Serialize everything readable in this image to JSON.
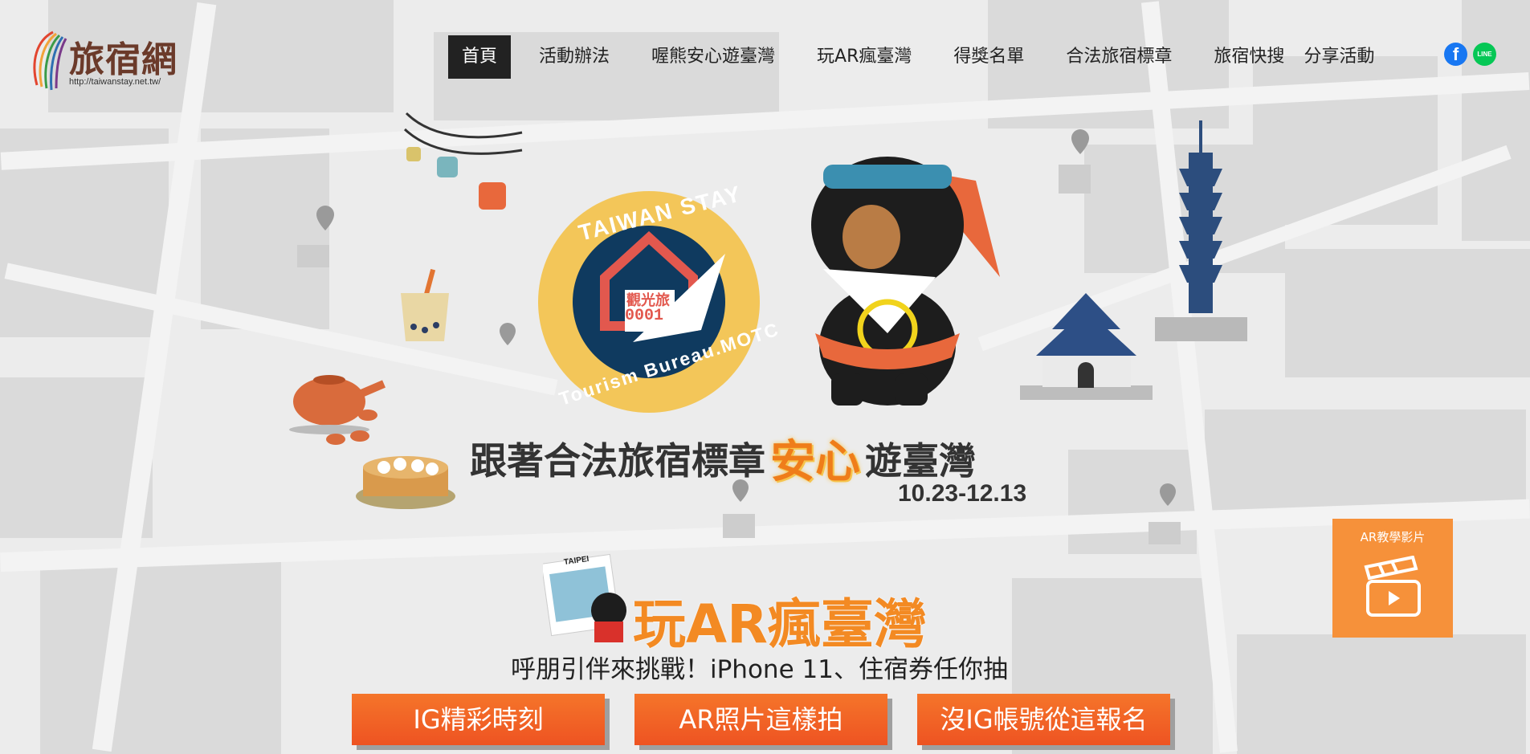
{
  "brand": {
    "name": "旅宿網",
    "url": "http://taiwanstay.net.tw/"
  },
  "nav": {
    "items": [
      {
        "label": "首頁",
        "active": true
      },
      {
        "label": "活動辦法"
      },
      {
        "label": "喔熊安心遊臺灣"
      },
      {
        "label": "玩AR瘋臺灣"
      },
      {
        "label": "得獎名單"
      },
      {
        "label": "合法旅宿標章"
      },
      {
        "label": "旅宿快搜"
      },
      {
        "label": "分享活動"
      }
    ],
    "social": {
      "facebook_icon": "facebook-icon",
      "facebook_glyph": "f",
      "line_icon": "line-icon",
      "line_glyph": "LINE"
    }
  },
  "hero": {
    "badge": {
      "top_text": "TAIWAN STAY",
      "bottom_text": "Tourism Bureau.MOTC",
      "label": "觀光旅",
      "number": "0001"
    },
    "headline_pre": "跟著合法旅宿標章",
    "headline_highlight": "安心",
    "headline_post": "遊臺灣",
    "dates": "10.23-12.13",
    "postcard_text": "TAIPEI"
  },
  "ar": {
    "title": "玩AR瘋臺灣",
    "subtitle": "呼朋引伴來挑戰！iPhone 11、住宿券任你抽",
    "buttons": [
      "IG精彩時刻",
      "AR照片這樣拍",
      "沒IG帳號從這報名"
    ],
    "video_label": "AR教學影片",
    "video_icon": "clapperboard-icon"
  },
  "colors": {
    "accent": "#f38a23",
    "button": "#ee5322",
    "navy": "#0f3a5f",
    "gold": "#f3c659",
    "badge_red": "#e2584e"
  }
}
